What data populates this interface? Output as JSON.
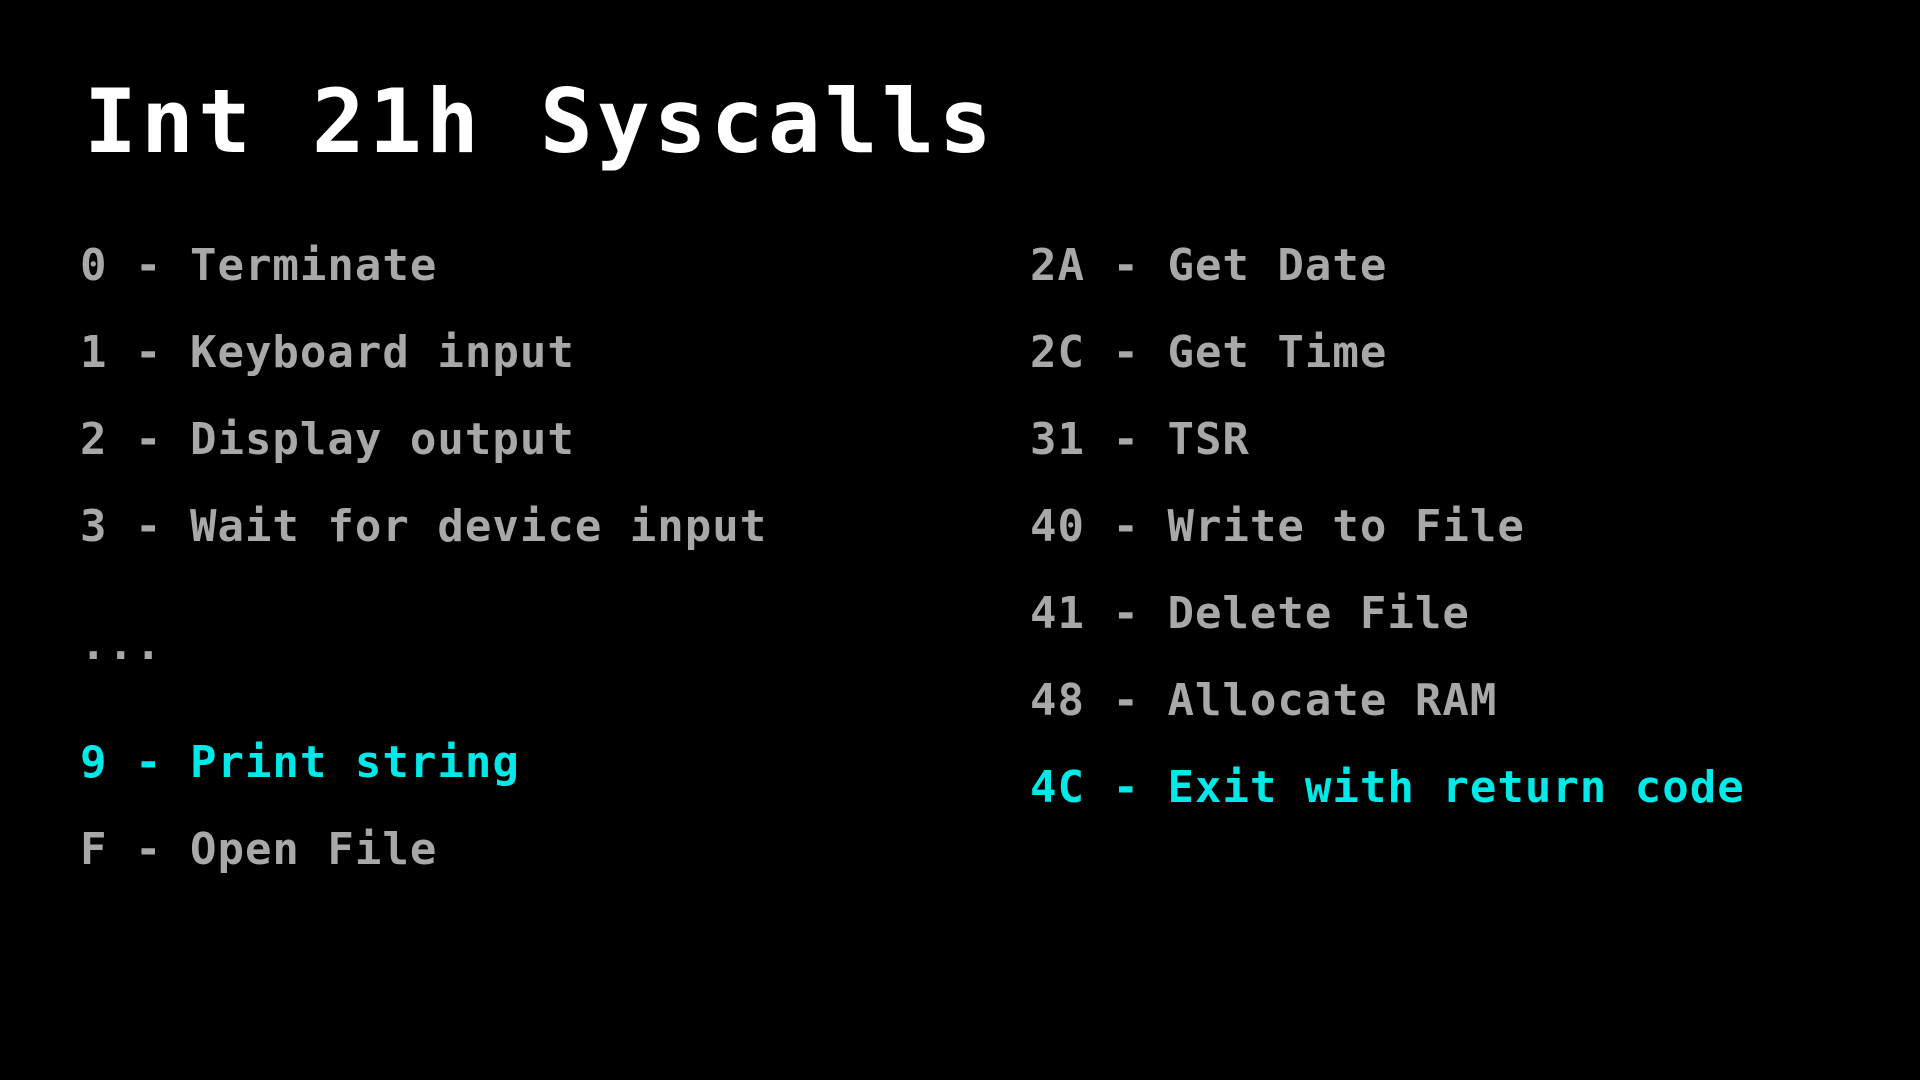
{
  "window": {
    "background_color": "#000000"
  },
  "header": {
    "title": "Int 21h Syscalls",
    "title_color": "#ffffff"
  },
  "palette": {
    "body_text": "#a8a8a8",
    "accent_text": "#00e9e9",
    "background": "#000000"
  },
  "columns": {
    "left": {
      "entries": [
        {
          "text": "0 - Terminate",
          "highlight": false
        },
        {
          "text": "1 - Keyboard input",
          "highlight": false
        },
        {
          "text": "2 - Display output",
          "highlight": false
        },
        {
          "text": "3 - Wait for device input",
          "highlight": false
        },
        {
          "text": "...",
          "highlight": false
        },
        {
          "text": "9 - Print string",
          "highlight": true
        },
        {
          "text": "F - Open File",
          "highlight": false
        }
      ]
    },
    "right": {
      "entries": [
        {
          "text": "2A - Get Date",
          "highlight": false
        },
        {
          "text": "2C - Get Time",
          "highlight": false
        },
        {
          "text": "31 - TSR",
          "highlight": false
        },
        {
          "text": "40 - Write to File",
          "highlight": false
        },
        {
          "text": "41 - Delete File",
          "highlight": false
        },
        {
          "text": "48 - Allocate RAM",
          "highlight": false
        },
        {
          "text": "4C - Exit with return code",
          "highlight": true
        }
      ]
    }
  }
}
